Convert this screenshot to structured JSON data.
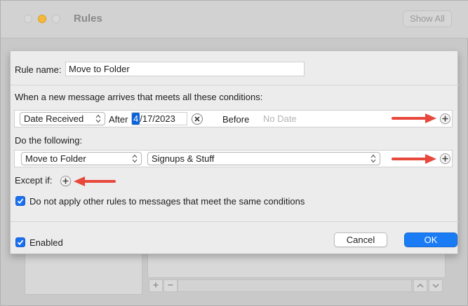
{
  "window": {
    "title": "Rules",
    "show_all_label": "Show All",
    "bg_add_label": "+",
    "bg_remove_label": "−"
  },
  "dialog": {
    "rule_name_label": "Rule name:",
    "rule_name_value": "Move to Folder",
    "conditions_header": "When a new message arrives that meets all these conditions:",
    "condition": {
      "field": "Date Received",
      "after_label": "After",
      "date_selected_part": "4",
      "date_rest": "/17/2023",
      "before_label": "Before",
      "before_placeholder": "No Date"
    },
    "actions_header": "Do the following:",
    "action": {
      "type": "Move to Folder",
      "target": "Signups & Stuff"
    },
    "except_label": "Except if:",
    "stop_rules_label": "Do not apply other rules to messages that meet the same conditions",
    "stop_rules_checked": true,
    "enabled_label": "Enabled",
    "enabled_checked": true,
    "cancel_label": "Cancel",
    "ok_label": "OK"
  },
  "colors": {
    "accent": "#1a7cf5",
    "annotation_arrow": "#e8473c"
  },
  "icons": [
    "add-condition-icon",
    "clear-date-icon",
    "chevron-updown-icon",
    "checkmark-icon",
    "red-arrow-annotation"
  ]
}
